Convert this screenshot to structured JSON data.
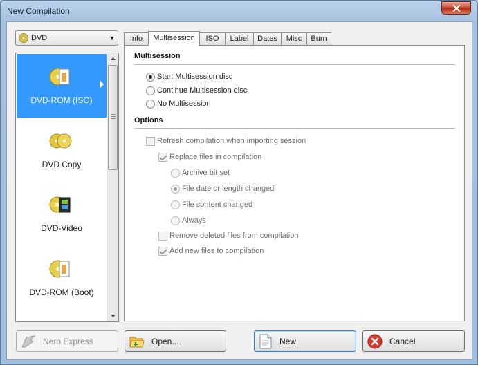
{
  "window": {
    "title": "New Compilation"
  },
  "type_select": {
    "value": "DVD"
  },
  "compilation_list": [
    {
      "label": "DVD-ROM (ISO)",
      "icon": "dvd-rom-iso-icon",
      "selected": true
    },
    {
      "label": "DVD Copy",
      "icon": "dvd-copy-icon",
      "selected": false
    },
    {
      "label": "DVD-Video",
      "icon": "dvd-video-icon",
      "selected": false
    },
    {
      "label": "DVD-ROM (Boot)",
      "icon": "dvd-rom-boot-icon",
      "selected": false
    }
  ],
  "tabs": [
    "Info",
    "Multisession",
    "ISO",
    "Label",
    "Dates",
    "Misc",
    "Burn"
  ],
  "active_tab": "Multisession",
  "multisession": {
    "title": "Multisession",
    "options": [
      {
        "label": "Start Multisession disc",
        "checked": true
      },
      {
        "label": "Continue Multisession disc",
        "checked": false
      },
      {
        "label": "No Multisession",
        "checked": false
      }
    ]
  },
  "options": {
    "title": "Options",
    "refresh": {
      "label": "Refresh compilation when importing session",
      "checked": false,
      "enabled": false
    },
    "replace": {
      "label": "Replace files in compilation",
      "checked": true,
      "enabled": false
    },
    "replace_modes": [
      {
        "label": "Archive bit set",
        "checked": false
      },
      {
        "label": "File date or length changed",
        "checked": true
      },
      {
        "label": "File content changed",
        "checked": false
      },
      {
        "label": "Always",
        "checked": false
      }
    ],
    "remove_deleted": {
      "label": "Remove deleted files from compilation",
      "checked": false,
      "enabled": false
    },
    "add_new": {
      "label": "Add new files to compilation",
      "checked": true,
      "enabled": false
    }
  },
  "buttons": {
    "nero_express": "Nero Express",
    "open": "Open...",
    "new": "New",
    "cancel": "Cancel"
  }
}
